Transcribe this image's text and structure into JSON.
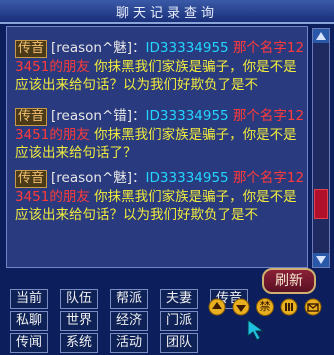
{
  "window": {
    "title": "聊天记录查询"
  },
  "messages": [
    {
      "tag": "传音",
      "sender": "[reason^魅]：",
      "id_text": "ID33334955",
      "name": "那个名字12",
      "name2": "3451的朋友",
      "text": "你抹黑我们家族是骗子，你是不是应该出来给句话？以为我们好欺负了是不"
    },
    {
      "tag": "传音",
      "sender": "[reason^错]：",
      "id_text": "ID33334955",
      "name": "那个名字12",
      "name2": "3451的朋友",
      "text": "你抹黑我们家族是骗子，你是不是应该出来给句话了？"
    },
    {
      "tag": "传音",
      "sender": "[reason^魅]：",
      "id_text": "ID33334955",
      "name": "那个名字12",
      "name2": "3451的朋友",
      "text": "你抹黑我们家族是骗子，你是不是应该出来给句话？以为我们好欺负了是不"
    }
  ],
  "channels": [
    [
      "当前",
      "队伍",
      "帮派",
      "夫妻",
      "传音"
    ],
    [
      "私聊",
      "世界",
      "经济",
      "门派"
    ],
    [
      "传闻",
      "系统",
      "活动",
      "团队"
    ]
  ],
  "refresh_label": "刷新",
  "toolbar_icons": [
    "up-arrow-icon",
    "down-arrow-icon",
    "ban-icon",
    "grid-icon",
    "mail-icon"
  ],
  "icon_labels": {
    "ban": "禁"
  }
}
